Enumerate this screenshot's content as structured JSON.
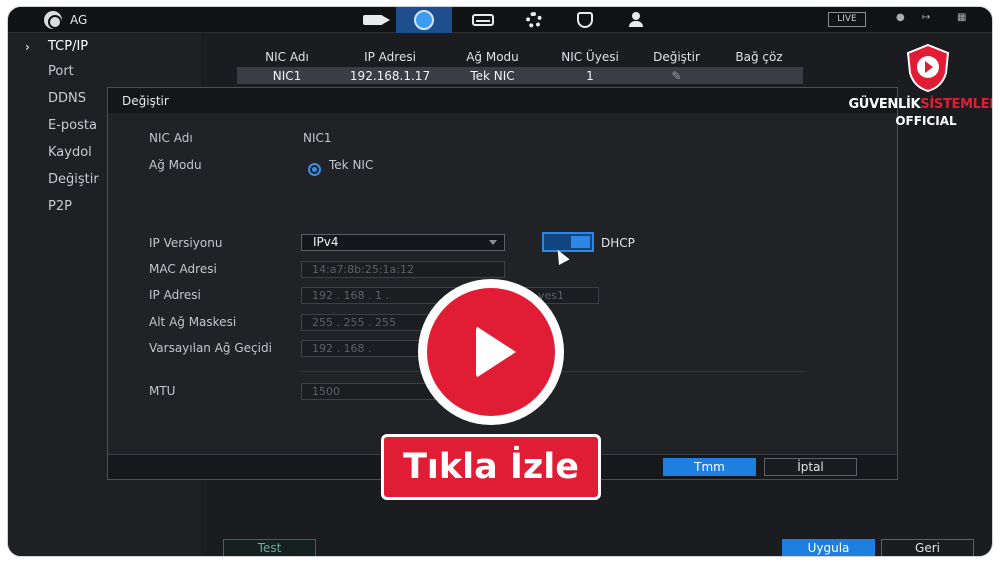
{
  "topbar": {
    "title": "AG",
    "live_label": "LIVE",
    "icons": [
      "camera-icon",
      "network-globe-icon",
      "storage-icon",
      "settings-gears-icon",
      "security-shield-icon",
      "account-users-icon"
    ],
    "accent": "#1d4f8c"
  },
  "sidebar": {
    "items": [
      {
        "label": "TCP/IP",
        "active": true
      },
      {
        "label": "Port"
      },
      {
        "label": "DDNS"
      },
      {
        "label": "E-posta"
      },
      {
        "label": "Kaydol"
      },
      {
        "label": "Değiştir"
      },
      {
        "label": "P2P"
      }
    ]
  },
  "nic_table": {
    "headers": [
      "NIC Adı",
      "IP Adresi",
      "Ağ Modu",
      "NIC Üyesi",
      "Değiştir",
      "Bağ çöz"
    ],
    "row": [
      "NIC1",
      "192.168.1.17",
      "Tek NIC",
      "1",
      "",
      ""
    ]
  },
  "dialog": {
    "title": "Değiştir",
    "nic_name_label": "NIC Adı",
    "nic_name_value": "NIC1",
    "net_mode_label": "Ağ Modu",
    "net_mode_option": "Tek NIC",
    "ip_version_label": "IP Versiyonu",
    "ip_version_value": "IPv4",
    "dhcp_label": "DHCP",
    "mac_label": "MAC Adresi",
    "mac_value": "14:a7:8b:25:1a:12",
    "ip_label": "IP Adresi",
    "ip_value": "192 . 168 . 1 .",
    "ip_extra": "ves1",
    "mask_label": "Alt Ağ Maskesi",
    "mask_value": "255 . 255 . 255",
    "gateway_label": "Varsayılan Ağ Geçidi",
    "gateway_value": "192 . 168 .",
    "mtu_label": "MTU",
    "mtu_value": "1500",
    "ok_label": "Tmm",
    "cancel_label": "İptal"
  },
  "footer": {
    "test_label": "Test",
    "apply_label": "Uygula",
    "back_label": "Geri"
  },
  "overlay": {
    "watch_label": "Tıkla İzle",
    "color": "#e11d35"
  },
  "logo": {
    "line1_a": "GÜVENLİK",
    "line1_b": "SİSTEMLERİ",
    "line2": "OFFICIAL"
  }
}
